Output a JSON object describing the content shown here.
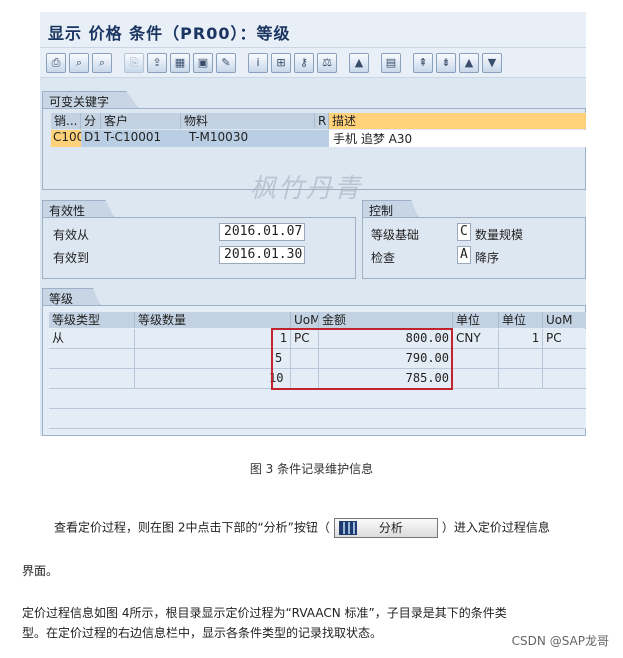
{
  "window": {
    "title": "显示 价格 条件（PR00）：等级"
  },
  "toolbar": {
    "icons": [
      "print-icon",
      "find-icon",
      "find-next-icon",
      "copy-icon",
      "export-icon",
      "calc-icon",
      "gift-icon",
      "edit-icon",
      "info-icon",
      "struct-icon",
      "key-icon",
      "scale-icon",
      "image-icon",
      "doc-icon",
      "first-page-icon",
      "last-page-icon",
      "up-icon",
      "down-icon"
    ]
  },
  "key_group": {
    "title": "可变关键字",
    "columns": [
      "销...",
      "分",
      "客户",
      "物料",
      "R",
      "描述"
    ],
    "row": {
      "sales_org": "C100",
      "dist": "D1",
      "customer": "T-C10001",
      "material": "T-M10030",
      "r": "",
      "description": "手机 追梦 A30"
    }
  },
  "validity": {
    "title": "有效性",
    "from_label": "有效从",
    "from_value": "2016.01.07",
    "to_label": "有效到",
    "to_value": "2016.01.30"
  },
  "control": {
    "title": "控制",
    "scale_base_label": "等级基础",
    "scale_base_code": "C",
    "scale_base_text": "数量规模",
    "check_label": "检查",
    "check_code": "A",
    "check_text": "降序"
  },
  "scales": {
    "title": "等级",
    "columns": [
      "等级类型",
      "等级数量",
      "UoM",
      "金额",
      "单位",
      "单位",
      "UoM"
    ],
    "rows": [
      {
        "type": "从",
        "qty": "1",
        "uom": "PC",
        "amount": "800.00",
        "currency": "CNY",
        "per": "1",
        "uom2": "PC"
      },
      {
        "type": "",
        "qty": "5",
        "uom": "",
        "amount": "790.00",
        "currency": "",
        "per": "",
        "uom2": ""
      },
      {
        "type": "",
        "qty": "10",
        "uom": "",
        "amount": "785.00",
        "currency": "",
        "per": "",
        "uom2": ""
      }
    ]
  },
  "watermark": "枫竹丹青",
  "caption": "图 3 条件记录维护信息",
  "body": {
    "p1_before": "查看定价过程，则在图 2中点击下部的“分析”按钮（",
    "analyze_button": "分析",
    "p1_after": "）进入定价过程信息",
    "p1_end": "界面。",
    "p2_line1": "定价过程信息如图 4所示，根目录显示定价过程为“RVAACN 标准”，子目录是其下的条件类",
    "p2_line2": "型。在定价过程的右边信息栏中，显示各条件类型的记录找取状态。"
  },
  "credit": "CSDN @SAP龙哥"
}
